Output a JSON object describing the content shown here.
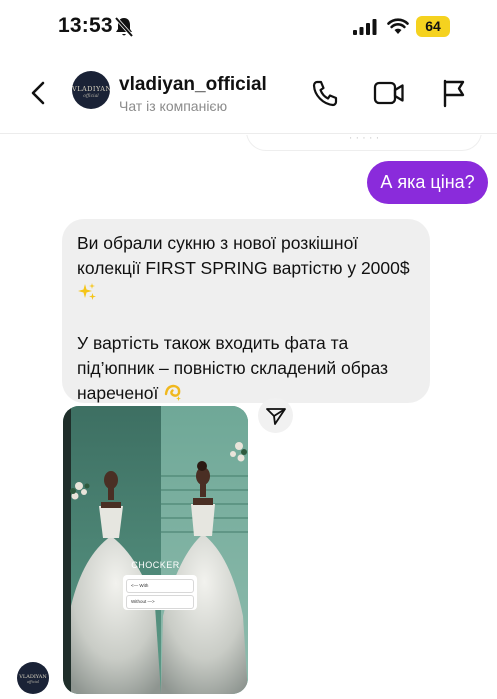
{
  "status_bar": {
    "time": "13:53",
    "battery": "64",
    "icons": [
      "bell-muted-icon",
      "cellular-signal-icon",
      "wifi-icon",
      "battery-icon"
    ],
    "battery_color": "#f5d21f"
  },
  "header": {
    "contact_name": "vladiyan_official",
    "subtitle": "Чат із компанією",
    "avatar_logo": "VLADIYAN",
    "avatar_logo_sub": "official",
    "actions": [
      "back-icon",
      "phone-icon",
      "video-icon",
      "flag-icon"
    ]
  },
  "messages": {
    "outgoing": {
      "text": "А яка ціна?",
      "color": "#8a2bdb"
    },
    "incoming": {
      "paragraph_1": "Ви обрали сукню з  нової розкішної колекції FIRST SPRING вартістю у 2000$",
      "paragraph_1_emoji": "sparkles-icon",
      "paragraph_2": "У вартість також входить фата та під’юпник – повністю складений образ нареченої",
      "paragraph_2_emoji": "dizzy-icon",
      "bubble_color": "#efefef"
    },
    "shared_post": {
      "choker_label": "CHOCKER",
      "poll_options": [
        "<— With",
        "Without —>"
      ]
    }
  }
}
